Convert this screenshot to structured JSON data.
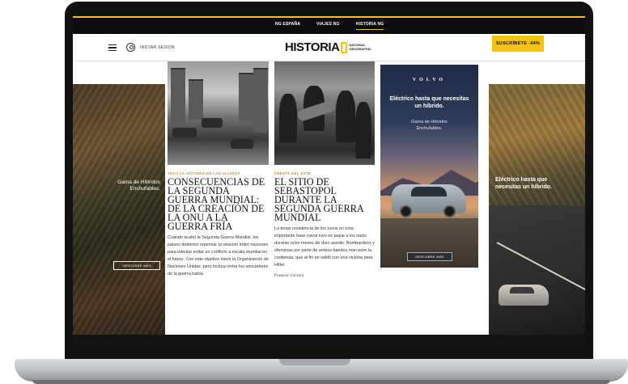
{
  "top_nav": {
    "links": [
      "NG ESPAÑA",
      "VIAJES NG",
      "HISTORIA NG"
    ],
    "active_index": 2
  },
  "header": {
    "login_label": "INICIAR SESIÓN",
    "logo_text": "HISTORIA",
    "logo_partner": "NATIONAL GEOGRAPHIC",
    "subscribe_label": "SUSCRÍBETE -44%"
  },
  "ads": {
    "brand": "VOLVO",
    "left_text": "Gama de Híbridos Enchufables.",
    "left_cta": "DESCUBRE MÁS",
    "middle_title": "Eléctrico hasta que necesitas un híbrido.",
    "middle_sub": "Gama de Híbridos Enchufables.",
    "middle_cta": "DESCUBRE MÁS",
    "right_text": "Eléctrico hasta que necesitas un híbrido."
  },
  "articles": [
    {
      "kicker": "TRAS LA VICTORIA DE LOS ALIADOS",
      "headline": "CONSECUENCIAS DE LA SEGUNDA GUERRA MUNDIAL: DE LA CREACIÓN DE LA ONU A LA GUERRA FRÍA",
      "dek": "Cuando acabó la Segunda Guerra Mundial, los países debieron repensar la relación entre naciones para intentar evitar un conflicto a escala mundial en el futuro. Con este objetivo nació la Organización de Naciones Unidas, pero incluso entre los vencedores de la guerra había"
    },
    {
      "kicker": "FRENTE DEL ESTE",
      "headline": "EL SITIO DE SEBASTOPOL DURANTE LA SEGUNDA GUERRA MUNDIAL",
      "dek": "La tenaz resistencia de los rusos en esta importante base naval tuvo en jaque a los nazis durante ocho meses de duro asedio. Bombardeos y ofensivas por parte de ambos bandos marcaron la contienda, que al fin se saldó con una victoria para Hitler.",
      "byline": "Francesc Cervera"
    }
  ]
}
